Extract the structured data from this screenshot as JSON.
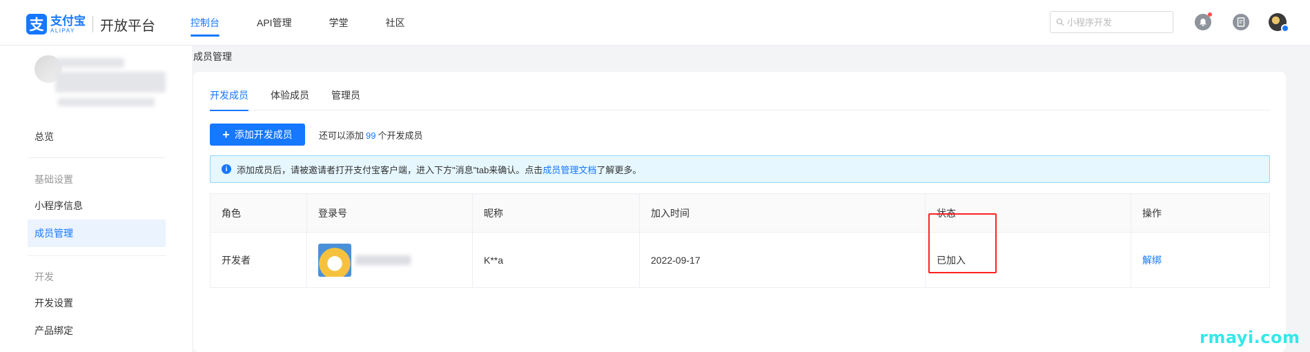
{
  "header": {
    "logo": {
      "cn": "支付宝",
      "en": "ALIPAY",
      "mark": "支"
    },
    "platform": "开放平台",
    "nav": [
      "控制台",
      "API管理",
      "学堂",
      "社区"
    ],
    "nav_active": 0,
    "search_placeholder": "小程序开发"
  },
  "sidebar": {
    "overview": "总览",
    "group_basic": "基础设置",
    "mini_info": "小程序信息",
    "member_mgmt": "成员管理",
    "group_dev": "开发",
    "dev_settings": "开发设置",
    "product_binding": "产品绑定"
  },
  "breadcrumb": "成员管理",
  "tabs": [
    "开发成员",
    "体验成员",
    "管理员"
  ],
  "tab_active": 0,
  "add_button": "添加开发成员",
  "quota": {
    "prefix": "还可以添加",
    "count": "99",
    "suffix": "个开发成员"
  },
  "alert": {
    "text": "添加成员后，请被邀请者打开支付宝客户端，进入下方\"消息\"tab来确认。点击",
    "link": "成员管理文档",
    "tail": "了解更多。"
  },
  "table": {
    "headers": [
      "角色",
      "登录号",
      "昵称",
      "加入时间",
      "状态",
      "操作"
    ],
    "rows": [
      {
        "role": "开发者",
        "nickname": "K**a",
        "joined": "2022-09-17",
        "status": "已加入",
        "action": "解绑"
      }
    ]
  },
  "watermark": "rmayi.com",
  "colors": {
    "accent": "#1677ff",
    "highlight": "#ff2020"
  }
}
